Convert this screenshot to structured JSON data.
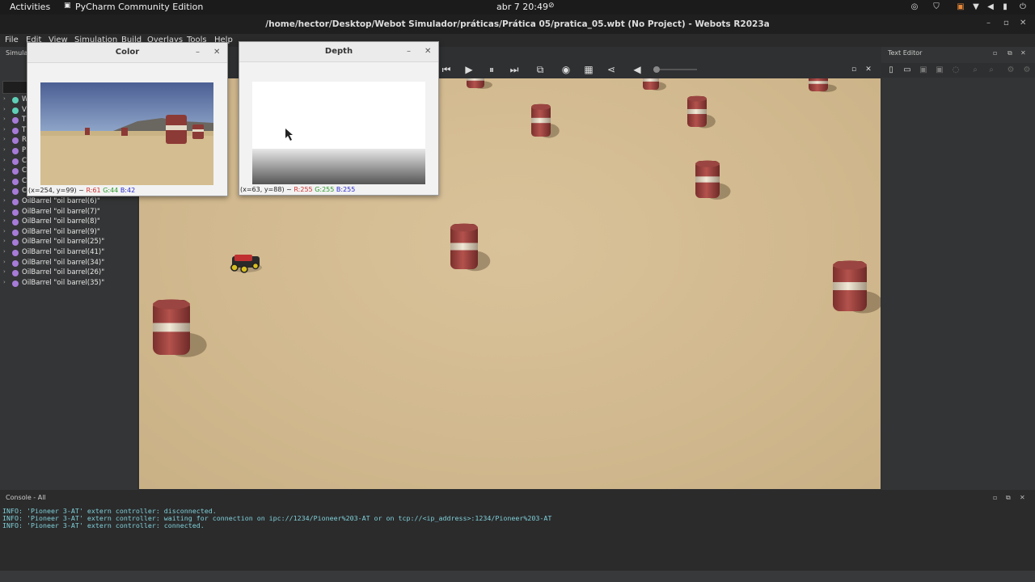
{
  "topbar": {
    "activities": "Activities",
    "app_name": "PyCharm Community Edition",
    "clock": "abr 7  20:49"
  },
  "window": {
    "title": "/home/hector/Desktop/Webot Simulador/práticas/Prática 05/pratica_05.wbt (No Project) - Webots R2023a"
  },
  "menu": [
    "File",
    "Edit",
    "View",
    "Simulation",
    "Build",
    "Overlays",
    "Tools",
    "Help"
  ],
  "scene_panel": {
    "title": "Simulat",
    "items": [
      {
        "label": "W",
        "color": "green"
      },
      {
        "label": "V",
        "color": "green"
      },
      {
        "label": "T",
        "color": "purple"
      },
      {
        "label": "T",
        "color": "purple"
      },
      {
        "label": "R",
        "color": "purple"
      },
      {
        "label": "P",
        "color": "purple"
      },
      {
        "label": "C",
        "color": "purple"
      },
      {
        "label": "C",
        "color": "purple"
      },
      {
        "label": "C",
        "color": "purple"
      },
      {
        "label": "C",
        "color": "purple"
      },
      {
        "label": "OilBarrel \"oil barrel(6)\"",
        "color": "purple"
      },
      {
        "label": "OilBarrel \"oil barrel(7)\"",
        "color": "purple"
      },
      {
        "label": "OilBarrel \"oil barrel(8)\"",
        "color": "purple"
      },
      {
        "label": "OilBarrel \"oil barrel(9)\"",
        "color": "purple"
      },
      {
        "label": "OilBarrel \"oil barrel(25)\"",
        "color": "purple"
      },
      {
        "label": "OilBarrel \"oil barrel(41)\"",
        "color": "purple"
      },
      {
        "label": "OilBarrel \"oil barrel(34)\"",
        "color": "purple"
      },
      {
        "label": "OilBarrel \"oil barrel(26)\"",
        "color": "purple"
      },
      {
        "label": "OilBarrel \"oil barrel(35)\"",
        "color": "purple"
      }
    ]
  },
  "color_window": {
    "title": "Color",
    "status_prefix": "(x=254, y=99) ~ ",
    "r": "R:61",
    "g": "G:44",
    "b": "B:42"
  },
  "depth_window": {
    "title": "Depth",
    "status_prefix": "(x=63, y=88) ~ ",
    "r": "R:255",
    "g": "G:255",
    "b": "B:255"
  },
  "right_panel": {
    "title": "Text Editor"
  },
  "console": {
    "title": "Console - All",
    "lines": [
      "INFO: 'Pioneer 3-AT' extern controller: disconnected.",
      "INFO: 'Pioneer 3-AT' extern controller: waiting for connection on ipc://1234/Pioneer%203-AT or on tcp://<ip_address>:1234/Pioneer%203-AT",
      "INFO: 'Pioneer 3-AT' extern controller: connected."
    ]
  },
  "colors": {
    "sand": "#d6bf94",
    "barrel_red": "#a84a46",
    "barrel_band": "#e7ddc8",
    "console_text": "#7fd0d8"
  }
}
